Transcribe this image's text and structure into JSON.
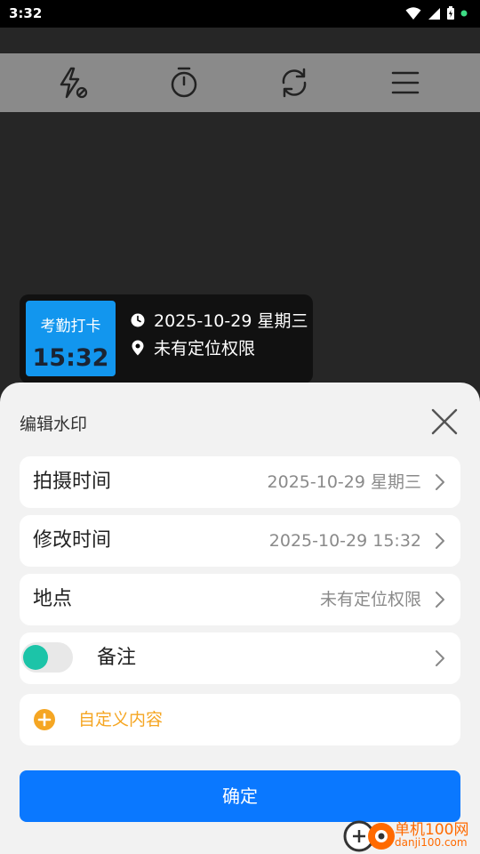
{
  "status_bar": {
    "time": "3:32"
  },
  "toolbar": {
    "icons": [
      "flash-off-icon",
      "timer-icon",
      "switch-camera-icon",
      "menu-icon"
    ]
  },
  "watermark": {
    "badge_title": "考勤打卡",
    "badge_time": "15:32",
    "datetime": "2025-10-29 星期三",
    "location": "未有定位权限",
    "badge_color": "#1296ee"
  },
  "sheet": {
    "title": "编辑水印",
    "rows": [
      {
        "label": "拍摄时间",
        "value": "2025-10-29 星期三"
      },
      {
        "label": "修改时间",
        "value": "2025-10-29 15:32"
      },
      {
        "label": "地点",
        "value": "未有定位权限"
      }
    ],
    "note": {
      "label": "备注",
      "enabled": true
    },
    "custom_label": "自定义内容",
    "confirm_label": "确定"
  },
  "brand": {
    "name": "单机100网",
    "url": "danji100.com"
  },
  "colors": {
    "accent": "#0a78ff",
    "toggle": "#1cc4a8",
    "custom": "#f5a623"
  }
}
